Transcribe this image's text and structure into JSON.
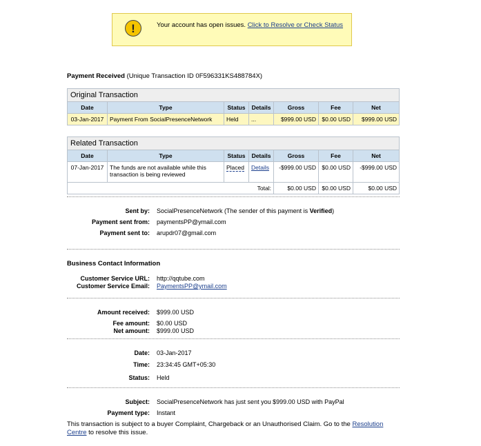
{
  "alert": {
    "icon": "warning-exclamation-icon",
    "message": "Your account has open issues.",
    "link": "Click to Resolve or Check Status"
  },
  "header": {
    "title": "Payment Received",
    "txn_id": "(Unique Transaction ID 0F596331KS488784X)"
  },
  "original": {
    "caption": "Original Transaction",
    "columns": [
      "Date",
      "Type",
      "Status",
      "Details",
      "Gross",
      "Fee",
      "Net"
    ],
    "row": {
      "date": "03-Jan-2017",
      "type": "Payment From SocialPresenceNetwork",
      "status": "Held",
      "details": "...",
      "gross": "$999.00 USD",
      "fee": "$0.00 USD",
      "net": "$999.00 USD"
    }
  },
  "related": {
    "caption": "Related Transaction",
    "columns": [
      "Date",
      "Type",
      "Status",
      "Details",
      "Gross",
      "Fee",
      "Net"
    ],
    "row": {
      "date": "07-Jan-2017",
      "type": "The funds are not available while this transaction is being reviewed",
      "status": "Placed",
      "details": "Details",
      "gross": "-$999.00 USD",
      "fee": "$0.00 USD",
      "net": "-$999.00 USD"
    },
    "total": {
      "label": "Total:",
      "gross": "$0.00 USD",
      "fee": "$0.00 USD",
      "net": "$0.00 USD"
    }
  },
  "sender": {
    "sent_by_label": "Sent by:",
    "sent_by_value": "SocialPresenceNetwork (The sender of this payment is ",
    "verified": "Verified",
    "sent_by_close": ")",
    "from_label": "Payment sent from:",
    "from_value": "paymentsPP@ymail.com",
    "to_label": "Payment sent to:",
    "to_value": "arupdr07@gmail.com"
  },
  "business": {
    "heading": "Business Contact Information",
    "url_label": "Customer Service URL:",
    "url_value": "http://qqtube.com",
    "email_label": "Customer Service Email:",
    "email_value": "PaymentsPP@ymail.com"
  },
  "amounts": {
    "received_label": "Amount received:",
    "received_value": "$999.00 USD",
    "fee_label": "Fee amount:",
    "fee_value": "$0.00 USD",
    "net_label": "Net amount:",
    "net_value": "$999.00 USD"
  },
  "datetime": {
    "date_label": "Date:",
    "date_value": "03-Jan-2017",
    "time_label": "Time:",
    "time_value": "23:34:45 GMT+05:30",
    "status_label": "Status:",
    "status_value": "Held"
  },
  "subject": {
    "subject_label": "Subject:",
    "subject_value": "SocialPresenceNetwork has just sent you $999.00 USD with PayPal",
    "type_label": "Payment type:",
    "type_value": "Instant"
  },
  "footer": {
    "text": "This transaction is subject to a buyer Complaint, Chargeback or an Unauthorised Claim. Go to the ",
    "link": "Resolution Centre",
    "text_end": " to resolve this issue."
  }
}
